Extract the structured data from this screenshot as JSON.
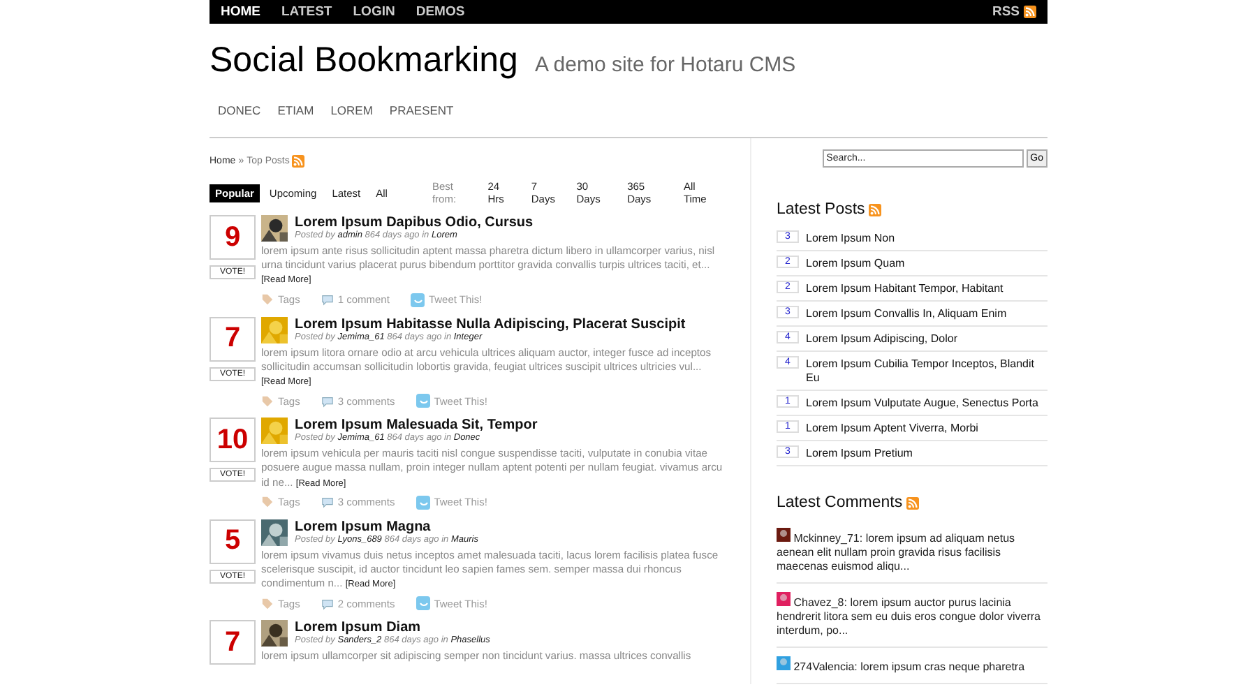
{
  "top_nav": {
    "items": [
      {
        "label": "HOME",
        "selected": true
      },
      {
        "label": "LATEST",
        "selected": false
      },
      {
        "label": "LOGIN",
        "selected": false
      },
      {
        "label": "DEMOS",
        "selected": false
      }
    ],
    "rss": "RSS"
  },
  "header": {
    "title": "Social Bookmarking",
    "tagline": "A demo site for Hotaru CMS"
  },
  "categories": [
    "DONEC",
    "ETIAM",
    "LOREM",
    "PRAESENT"
  ],
  "breadcrumb": {
    "home": "Home",
    "separator": "»",
    "current": "Top Posts"
  },
  "tabs": [
    {
      "label": "Popular",
      "selected": true
    },
    {
      "label": "Upcoming",
      "selected": false
    },
    {
      "label": "Latest",
      "selected": false
    },
    {
      "label": "All",
      "selected": false
    }
  ],
  "best_from": {
    "label": "Best from:",
    "options": [
      "24 Hrs",
      "7 Days",
      "30 Days",
      "365 Days",
      "All Time"
    ]
  },
  "posts": [
    {
      "votes": "9",
      "vote_label": "VOTE!",
      "title": "Lorem Ipsum Dapibus Odio, Cursus",
      "posted_by": "Posted by",
      "author": "admin",
      "age": "864 days ago in",
      "category": "Lorem",
      "excerpt": "lorem ipsum ante risus sollicitudin aptent massa pharetra dictum libero in ullamcorper varius, nisl urna tincidunt varius placerat purus bibendum porttitor gravida convallis turpis ultrices taciti, et...",
      "read_more": "[Read More]",
      "tags": "Tags",
      "comments": "1 comment",
      "tweet": "Tweet This!"
    },
    {
      "votes": "7",
      "vote_label": "VOTE!",
      "title": "Lorem Ipsum Habitasse Nulla Adipiscing, Placerat Suscipit",
      "posted_by": "Posted by",
      "author": "Jemima_61",
      "age": "864 days ago in",
      "category": "Integer",
      "excerpt": "lorem ipsum litora ornare odio at arcu vehicula ultrices aliquam auctor, integer fusce ad inceptos sollicitudin accumsan sollicitudin lobortis gravida, feugiat ultrices suscipit ultrices ultricies vul...",
      "read_more": "[Read More]",
      "tags": "Tags",
      "comments": "3 comments",
      "tweet": "Tweet This!"
    },
    {
      "votes": "10",
      "vote_label": "VOTE!",
      "title": "Lorem Ipsum Malesuada Sit, Tempor",
      "posted_by": "Posted by",
      "author": "Jemima_61",
      "age": "864 days ago in",
      "category": "Donec",
      "excerpt": "lorem ipsum vehicula per mauris taciti nisl congue suspendisse taciti, vulputate in conubia vitae posuere augue massa nullam, proin integer nullam aptent potenti per nullam feugiat. vivamus arcu id ne...",
      "read_more": "[Read More]",
      "tags": "Tags",
      "comments": "3 comments",
      "tweet": "Tweet This!"
    },
    {
      "votes": "5",
      "vote_label": "VOTE!",
      "title": "Lorem Ipsum Magna",
      "posted_by": "Posted by",
      "author": "Lyons_689",
      "age": "864 days ago in",
      "category": "Mauris",
      "excerpt": "lorem ipsum vivamus duis netus inceptos amet malesuada taciti, lacus lorem facilisis platea fusce scelerisque suscipit, id auctor tincidunt leo sapien fames sem. semper massa dui rhoncus condimentum n...",
      "read_more": "[Read More]",
      "tags": "Tags",
      "comments": "2 comments",
      "tweet": "Tweet This!"
    },
    {
      "votes": "7",
      "title": "Lorem Ipsum Diam",
      "posted_by": "Posted by",
      "author": "Sanders_2",
      "age": "864 days ago in",
      "category": "Phasellus",
      "excerpt": "lorem ipsum ullamcorper sit adipiscing semper non tincidunt varius. massa ultrices convallis"
    }
  ],
  "search": {
    "placeholder": "Search...",
    "button": "Go"
  },
  "latest_posts": {
    "title": "Latest Posts",
    "items": [
      {
        "count": "3",
        "title": "Lorem Ipsum Non"
      },
      {
        "count": "2",
        "title": "Lorem Ipsum Quam"
      },
      {
        "count": "2",
        "title": "Lorem Ipsum Habitant Tempor, Habitant"
      },
      {
        "count": "3",
        "title": "Lorem Ipsum Convallis In, Aliquam Enim"
      },
      {
        "count": "4",
        "title": "Lorem Ipsum Adipiscing, Dolor"
      },
      {
        "count": "4",
        "title": "Lorem Ipsum Cubilia Tempor Inceptos, Blandit Eu"
      },
      {
        "count": "1",
        "title": "Lorem Ipsum Vulputate Augue, Senectus Porta"
      },
      {
        "count": "1",
        "title": "Lorem Ipsum Aptent Viverra, Morbi"
      },
      {
        "count": "3",
        "title": "Lorem Ipsum Pretium"
      }
    ]
  },
  "latest_comments": {
    "title": "Latest Comments",
    "items": [
      {
        "author": "Mckinney_71:",
        "text": "lorem ipsum ad aliquam netus aenean elit nullam proin gravida risus facilisis maecenas euismod aliqu..."
      },
      {
        "author": "Chavez_8:",
        "text": "lorem ipsum auctor purus lacinia hendrerit litora sem eu duis eros congue dolor viverra interdum, po..."
      },
      {
        "author": "274Valencia:",
        "text": "lorem ipsum cras neque pharetra"
      }
    ]
  }
}
